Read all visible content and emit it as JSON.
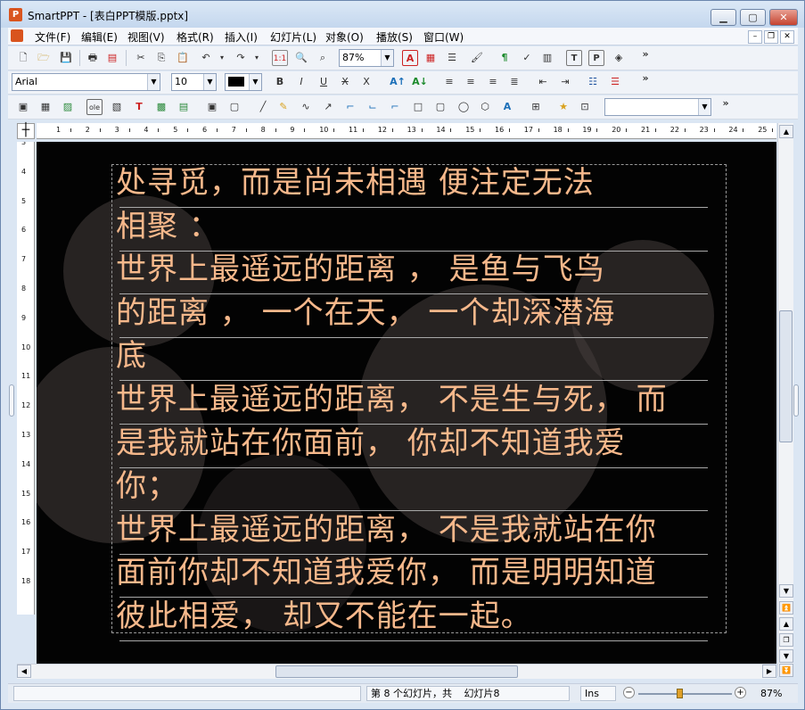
{
  "window": {
    "title": "SmartPPT - [表白PPT模版.pptx]",
    "app_icon": "P"
  },
  "menu": [
    "文件(F)",
    "编辑(E)",
    "视图(V)",
    "格式(R)",
    "插入(I)",
    "幻灯片(L)",
    "对象(O)",
    "播放(S)",
    "窗口(W)"
  ],
  "toolbar": {
    "zoom": "87%",
    "font_name": "Arial",
    "font_size": "10",
    "more": "»"
  },
  "ruler_h": [
    "1",
    "2",
    "3",
    "4",
    "5",
    "6",
    "7",
    "8",
    "9",
    "10",
    "11",
    "12",
    "13",
    "14",
    "15",
    "16",
    "17",
    "18",
    "19",
    "20",
    "21",
    "22",
    "23",
    "24",
    "25"
  ],
  "ruler_v": [
    "3",
    "4",
    "5",
    "6",
    "7",
    "8",
    "9",
    "10",
    "11",
    "12",
    "13",
    "14",
    "15",
    "16",
    "17",
    "18"
  ],
  "slide": {
    "lines": [
      "处寻觅，而是尚未相遇 便注定无法",
      "相聚 ：",
      "世界上最遥远的距离 ， 是鱼与飞鸟",
      "的距离 ， 一个在天， 一个却深潜海",
      "底",
      "世界上最遥远的距离， 不是生与死， 而",
      "是我就站在你面前， 你却不知道我爱",
      "你；",
      "世界上最遥远的距离， 不是我就站在你",
      "面前你却不知道我爱你， 而是明明知道",
      "彼此相爱， 却又不能在一起。"
    ],
    "text_color": "#f6b88b",
    "background_color": "#030303"
  },
  "status": {
    "slide_info": "第 8 个幻灯片，共",
    "slide_name": "幻灯片8",
    "mode": "Ins",
    "zoom": "87%"
  }
}
